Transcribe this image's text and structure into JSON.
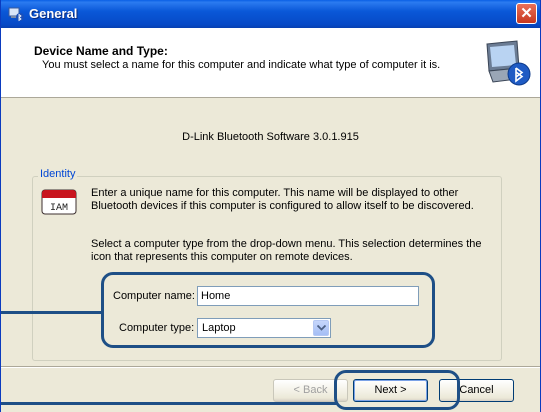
{
  "window": {
    "title": "General"
  },
  "header": {
    "title": "Device Name and Type:",
    "subtitle": "You must select a name for this computer and indicate what type of computer it is."
  },
  "software_version": "D-Link Bluetooth Software 3.0.1.915",
  "identity": {
    "group_label": "Identity",
    "paragraph1": "Enter a unique name for this computer.  This name will be displayed to other Bluetooth devices if this computer is configured to allow itself to be discovered.",
    "paragraph2": "Select a computer type from the drop-down menu.  This selection determines the icon that represents this computer on remote devices.",
    "name_label": "Computer name:",
    "name_value": "Home",
    "type_label": "Computer type:",
    "type_value": "Laptop"
  },
  "buttons": {
    "back": "< Back",
    "next": "Next >",
    "cancel": "Cancel"
  },
  "icons": {
    "title": "bluetooth-device-icon",
    "header": "computer-bluetooth-icon",
    "identity": "hello-i-am-badge-icon",
    "close": "close-icon",
    "dropdown": "chevron-down-icon"
  },
  "colors": {
    "titlebar": "#0a5fe5",
    "group_label": "#0046d5",
    "callout": "#1e4f86"
  }
}
